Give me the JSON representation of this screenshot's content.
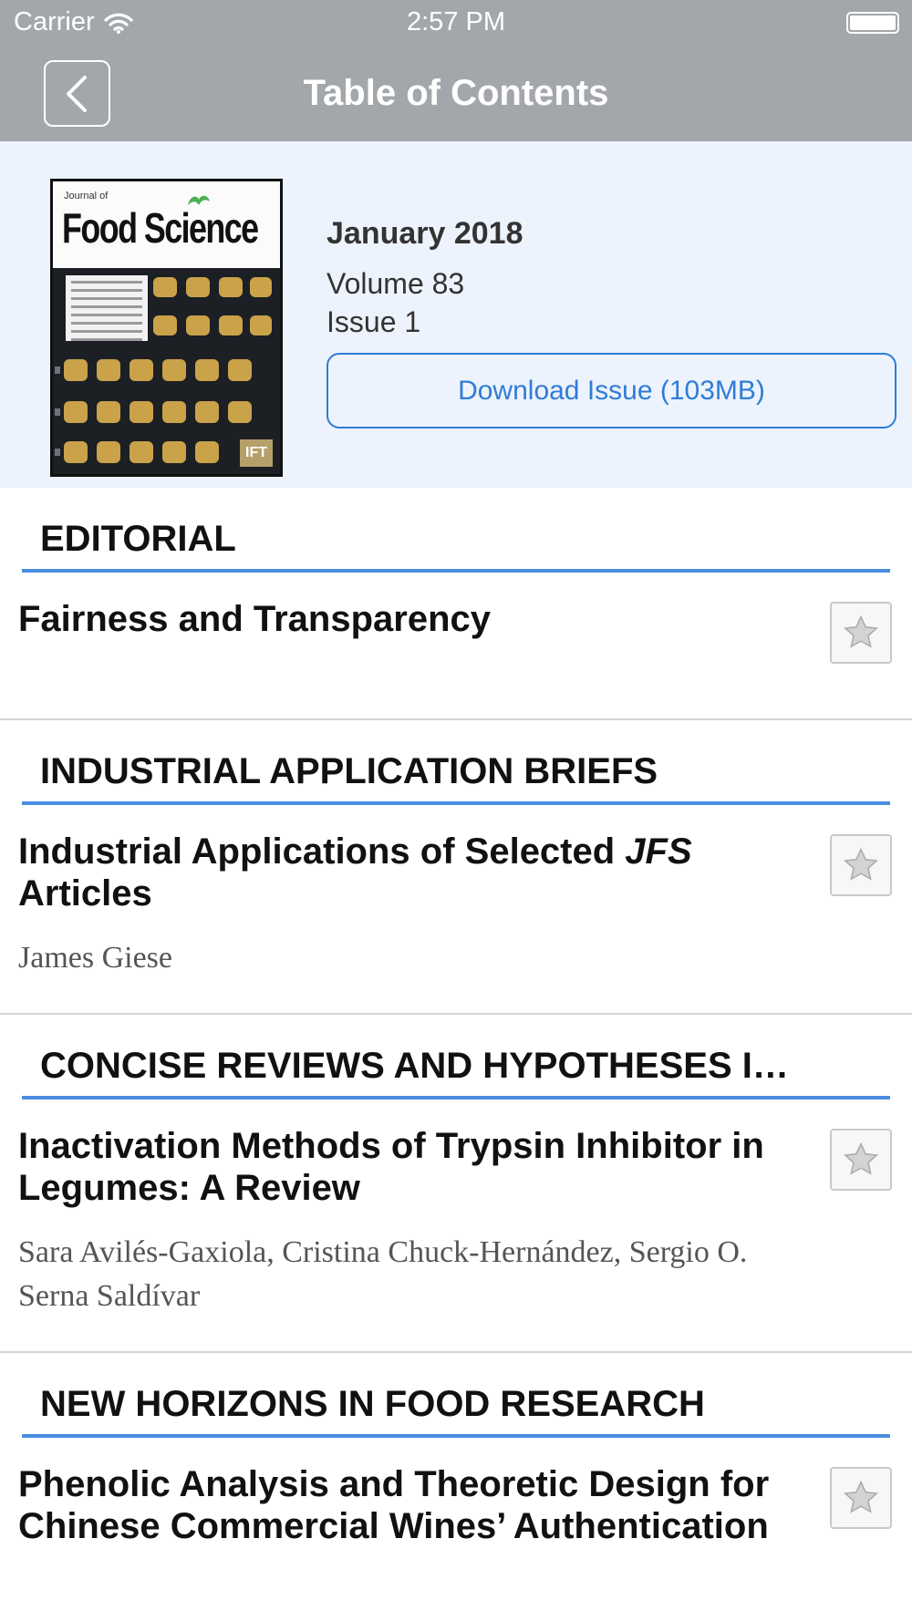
{
  "status_bar": {
    "carrier": "Carrier",
    "time": "2:57 PM"
  },
  "nav": {
    "title": "Table of Contents",
    "back_icon": "chevron-left-icon"
  },
  "issue": {
    "cover": {
      "journal_label": "Journal of",
      "title": "Food Science",
      "badge": "IFT"
    },
    "date": "January 2018",
    "volume": "Volume 83",
    "issue": "Issue 1",
    "download_label": "Download Issue (103MB)"
  },
  "sections": [
    {
      "heading": "EDITORIAL",
      "article": {
        "title": "Fairness and Transparency",
        "authors": ""
      }
    },
    {
      "heading": "INDUSTRIAL APPLICATION BRIEFS",
      "article": {
        "title_plain": "Industrial Applications of Selected ",
        "title_italic": "JFS",
        "title_rest": "Articles",
        "authors": "James Giese"
      }
    },
    {
      "heading": "CONCISE REVIEWS AND HYPOTHESES I…",
      "article": {
        "title": "Inactivation Methods of Trypsin Inhibitor in Legumes: A Review",
        "authors": "Sara Avilés-Gaxiola, Cristina Chuck-Hernández, Sergio O. Serna Saldívar"
      }
    },
    {
      "heading": "NEW HORIZONS IN FOOD RESEARCH",
      "article": {
        "title": "Phenolic Analysis and Theoretic Design for Chinese Commercial Wines’ Authentication",
        "authors": ""
      }
    }
  ],
  "colors": {
    "nav_bar": "#a3a7ab",
    "header_bg": "#edf3fc",
    "accent": "#2f7cd6",
    "section_rule": "#4a8de0"
  },
  "icons": {
    "favorite": "star-icon",
    "wifi": "wifi-icon",
    "battery": "battery-icon"
  }
}
